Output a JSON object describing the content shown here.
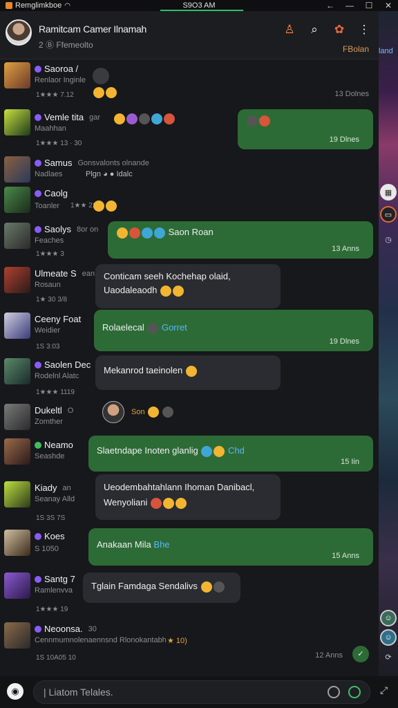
{
  "statusbar": {
    "app_name": "Remglimkboe",
    "time": "S9O3 AM",
    "wifi_icon": "wifi-icon"
  },
  "header": {
    "title": "Ramitcam Camer Ilnamah",
    "subtitle": "2  Ⓑ  Ffemeolto",
    "right_label": "FBolan",
    "side_label": "land",
    "icons": [
      "add-person-icon",
      "search-icon",
      "gift-icon",
      "more-vert-icon"
    ]
  },
  "chats": [
    {
      "name": "Saoroa /",
      "status": "Renlaor Inginle",
      "meta": "1★★★ 7.12",
      "time": "13 Dolnes"
    },
    {
      "name": "Vemle tita",
      "extra": "gar",
      "status": "Maahhan",
      "meta": "1★★★ 13 · 30",
      "bubble": "",
      "bubble_time": "19 Dlnes"
    },
    {
      "name": "Samus",
      "extra": "Gonsvalonts olnande",
      "status": "Nadlaes",
      "inline": "Plgn  ◕  ● Idalc"
    },
    {
      "name": "Caolg",
      "status": "Toanler",
      "meta": "1★★ 21:0"
    },
    {
      "name": "Saolys",
      "extra": "8or on",
      "status": "Feaches",
      "meta": "1★★★ 3",
      "bubble": "Saon  Roan",
      "bubble_time": "13 Anns"
    },
    {
      "name": "Ulmeate S",
      "extra": "ean",
      "status": "Rosaun",
      "meta": "1★ 30 3/8",
      "bubble_line1": "Conticam seeh Kochehap olaid,",
      "bubble_line2": "Uaodaleaodh"
    },
    {
      "name": "Ceeny Foat",
      "status": "Weidier",
      "meta": "1S 3:03",
      "bubble": "Rolaelecal",
      "bubble_link": "Gorret",
      "bubble_time": "19 Dlnes"
    },
    {
      "name": "Saolen Dec",
      "status": "Rodelnl Alatc",
      "meta": "1★★★ 1119",
      "bubble": "Mekanrod taeinolen"
    },
    {
      "name": "Dukeltl",
      "extra": "O",
      "status": "Zomther",
      "inline": "Son"
    },
    {
      "name": "Neamo",
      "status": "Seashde",
      "bubble": "Slaetndape Inoten glanlig",
      "bubble_link": "Chd",
      "bubble_time": "15 Iin"
    },
    {
      "name": "Kiady",
      "extra": "an",
      "status": "Seanay Alld",
      "meta": "1S 3S 7S",
      "bubble_line1": "Ueodembahtahlann Ihoman Danibacl,",
      "bubble_line2": "Wenyoliani"
    },
    {
      "name": "Koes",
      "status": "S 1050",
      "bubble": "Anakaan Mila",
      "bubble_link": "Bhe",
      "bubble_time": "15 Anns"
    },
    {
      "name": "Santg 7",
      "status": "Ramlenvva",
      "meta": "1★★★ 19",
      "bubble": "Tglain Famdaga Sendalivs"
    },
    {
      "name": "Neoonsa.",
      "extra": "30",
      "status": "Cennmumnolenaennsnd Rlonokantabho",
      "inline_tail": "★ 10)",
      "meta": "1S 10A05 10",
      "time": "12 Anns"
    }
  ],
  "input": {
    "placeholder": "| Liatom Telales."
  }
}
